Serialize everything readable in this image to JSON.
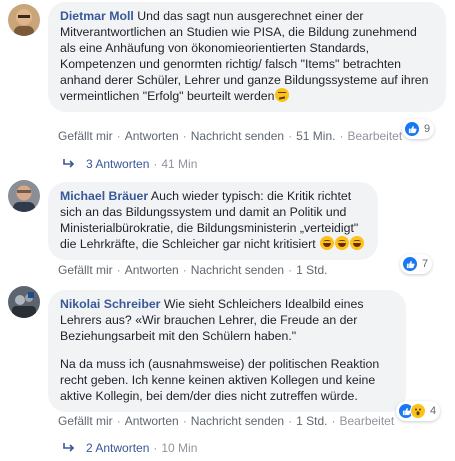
{
  "comments": [
    {
      "author": "Dietmar Moll",
      "text": "Und das sagt nun ausgerechnet einer der Mitverantwortlichen an Studien wie PISA, die Bildung zunehmend als eine Anhäufung von ökonomieorientierten Standards, Kompetenzen und genormten richtig/ falsch \"Items\" betrachten anhand derer Schüler, Lehrer und ganze Bildungssysteme auf ihren vermeintlichen \"Erfolg\" beurteilt werden",
      "emoji": "thinking-face-emoji",
      "actions": {
        "like": "Gefällt mir",
        "reply": "Antworten",
        "message": "Nachricht senden",
        "time": "51 Min.",
        "edited": "Bearbeitet"
      },
      "reaction_count": "9",
      "replies": {
        "label": "3 Antworten",
        "time": "41 Min"
      }
    },
    {
      "author": "Michael Bräuer",
      "text": "Auch wieder typisch: die Kritik richtet sich an das Bildungssystem und damit an Politik und Ministerialbürokratie, die Bildungsministerin „verteidigt\" die Lehrkräfte, die Schleicher gar nicht kritisiert",
      "emoji": "grinning-face-emoji",
      "actions": {
        "like": "Gefällt mir",
        "reply": "Antworten",
        "message": "Nachricht senden",
        "time": "1 Std."
      },
      "reaction_count": "7"
    },
    {
      "author": "Nikolai Schreiber",
      "text": "Wie sieht Schleichers Idealbild eines Lehrers aus? «Wir brauchen Lehrer, die Freude an der Beziehungsarbeit mit den Schülern haben.\"",
      "text2": "Na da muss ich (ausnahmsweise) der politischen Reaktion recht geben. Ich kenne keinen aktiven Kollegen und keine aktive Kollegin, bei dem/der dies nicht zutreffen würde.",
      "actions": {
        "like": "Gefällt mir",
        "reply": "Antworten",
        "message": "Nachricht senden",
        "time": "1 Std.",
        "edited": "Bearbeitet"
      },
      "reaction_count": "4",
      "replies": {
        "label": "2 Antworten",
        "time": "10 Min"
      }
    }
  ],
  "colors": {
    "link": "#385898",
    "bubble": "#f2f3f5",
    "like": "#1877f2",
    "meta": "#606770"
  }
}
